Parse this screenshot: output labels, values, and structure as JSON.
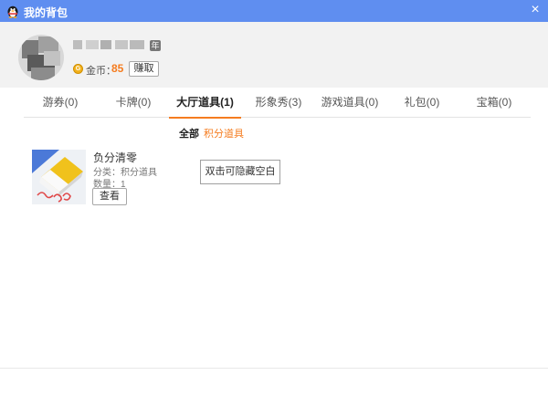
{
  "window": {
    "title": "我的背包",
    "icons": {
      "app": "qq-penguin-icon",
      "close": "close-icon"
    },
    "close_glyph": "×"
  },
  "profile": {
    "year_badge": "年",
    "gold_label": "金币：",
    "gold_value": "85",
    "earn_button": "赚取",
    "gold_icon_glyph": "G"
  },
  "tabs": [
    {
      "label": "游券(0)"
    },
    {
      "label": "卡牌(0)"
    },
    {
      "label": "大厅道具(1)",
      "active": true
    },
    {
      "label": "形象秀(3)"
    },
    {
      "label": "游戏道具(0)"
    },
    {
      "label": "礼包(0)"
    },
    {
      "label": "宝箱(0)"
    }
  ],
  "subfilter": {
    "all": "全部",
    "points_items": "积分道具"
  },
  "items": [
    {
      "name": "负分清零",
      "category": "分类：积分道具",
      "quantity": "数量：1",
      "view_button": "查看",
      "icon": "eraser-icon"
    }
  ],
  "hint": "双击可隐藏空白",
  "colors": {
    "titlebar": "#5f8ef0",
    "accent": "#f57c1f",
    "header_bg": "#f2f2f2"
  }
}
